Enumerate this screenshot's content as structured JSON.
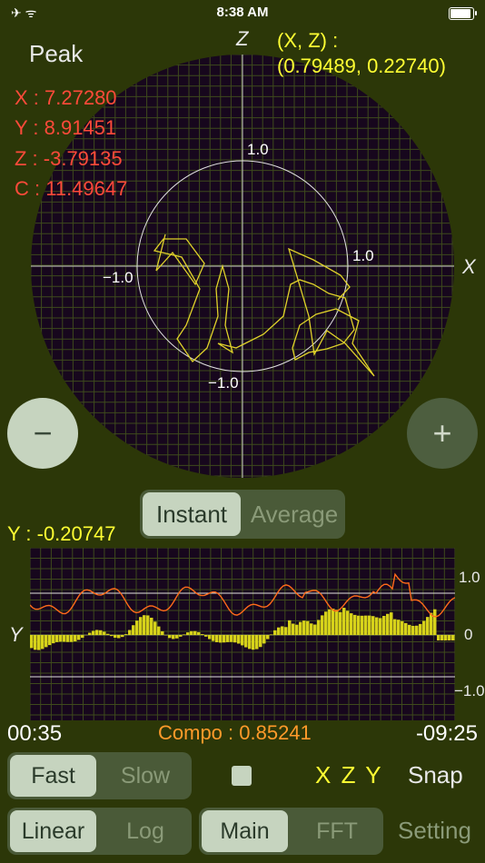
{
  "status": {
    "time": "8:38 AM",
    "left_icons": "✈ ᯤ"
  },
  "peak": {
    "label": "Peak",
    "x": "X : 7.27280",
    "y": "Y : 8.91451",
    "z": "Z : -3.79135",
    "c": "C : 11.49647"
  },
  "xz": {
    "label": "(X, Z)  :",
    "value": "(0.79489, 0.22740)"
  },
  "axes": {
    "z": "Z",
    "x": "X",
    "pos": "1.0",
    "neg": "−1.0",
    "y": "Y"
  },
  "buttons": {
    "minus": "−",
    "plus": "+"
  },
  "mode": {
    "instant": "Instant",
    "average": "Average"
  },
  "y_value": "Y : -0.20747",
  "graph_ticks": {
    "top": "1.0",
    "mid": "0",
    "bottom": "−1.0"
  },
  "times": {
    "left": "00:35",
    "right": "-09:25"
  },
  "compo": "Compo : 0.85241",
  "speed": {
    "fast": "Fast",
    "slow": "Slow"
  },
  "xzy": "X Z Y",
  "snap": "Snap",
  "scale": {
    "linear": "Linear",
    "log": "Log"
  },
  "view": {
    "main": "Main",
    "fft": "FFT"
  },
  "setting": "Setting",
  "colors": {
    "background": "#2c3708",
    "plot_bg": "#17071d",
    "yellow": "#ffff33",
    "red": "#ff4a3a",
    "orange": "#ff9a2a"
  }
}
